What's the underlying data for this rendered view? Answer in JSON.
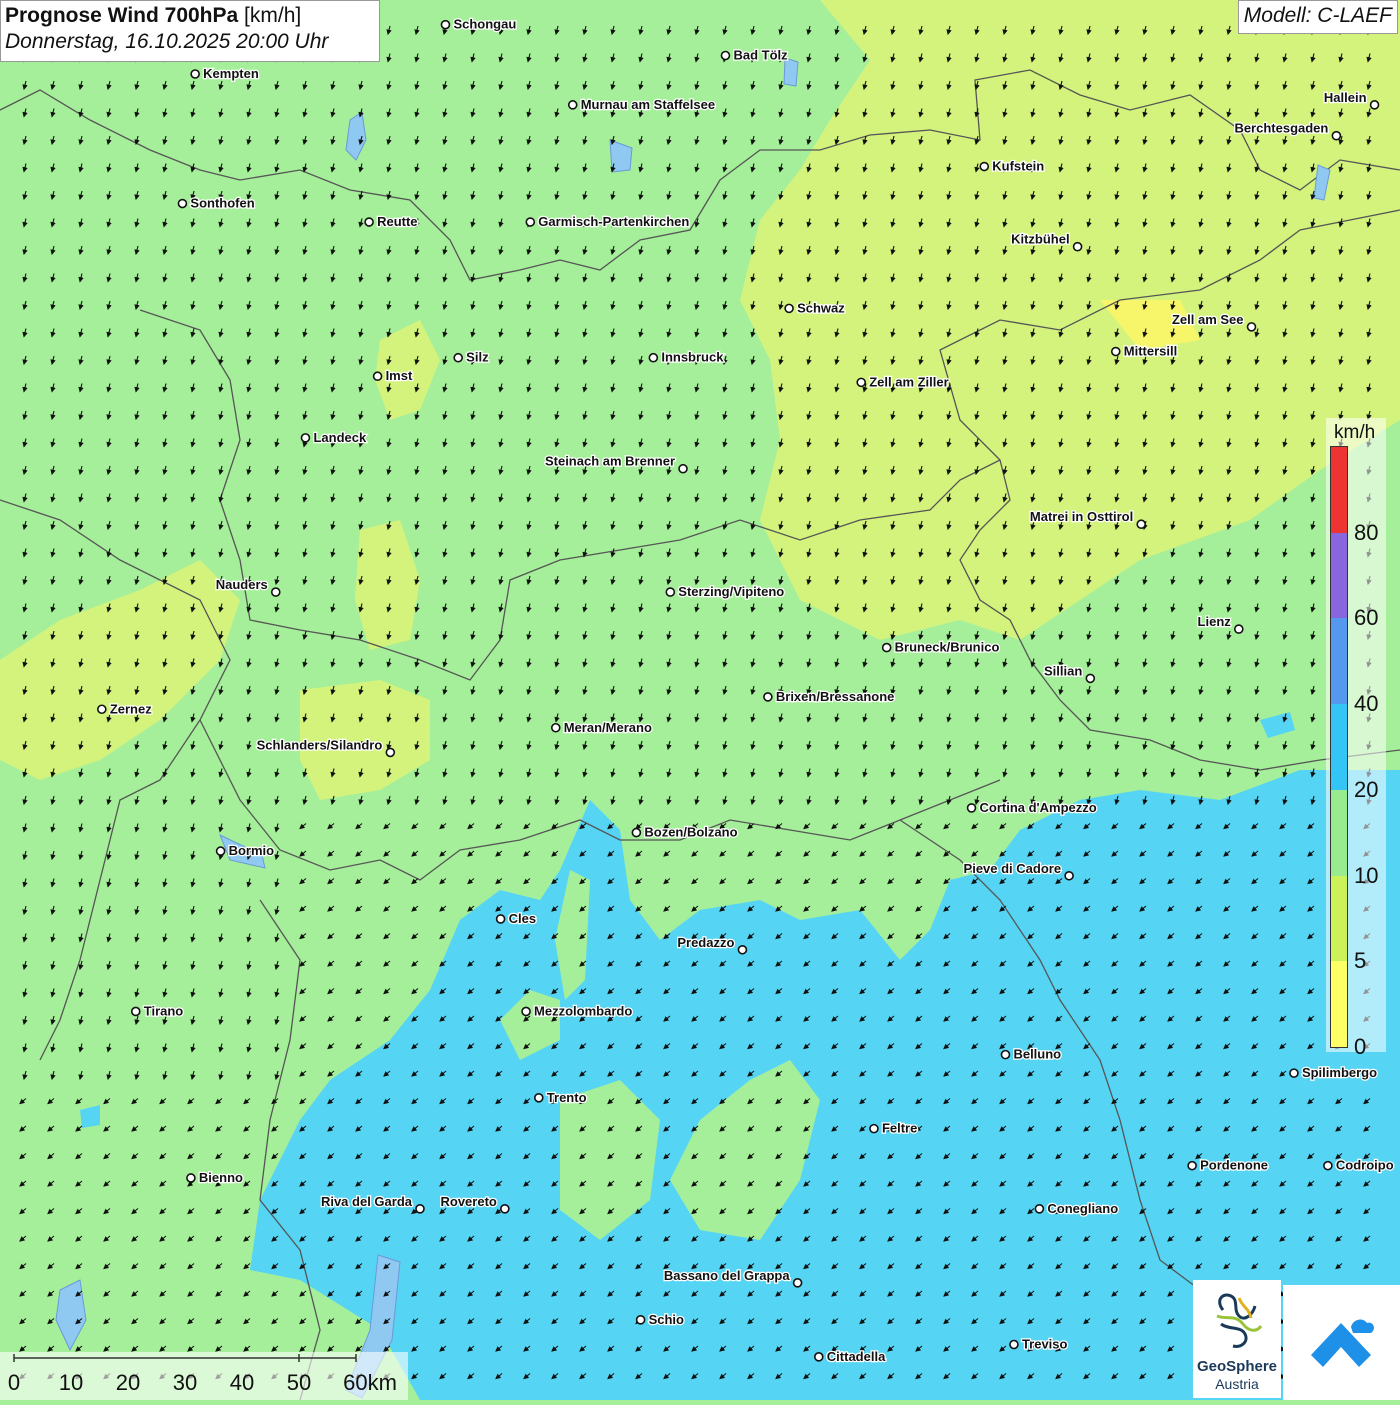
{
  "header": {
    "title_bold": "Prognose Wind 700hPa",
    "title_unit": "[km/h]",
    "subtitle": "Donnerstag, 16.10.2025 20:00 Uhr",
    "model": "Modell: C-LAEF"
  },
  "legend": {
    "unit": "km/h",
    "ticks": [
      "0",
      "5",
      "10",
      "20",
      "40",
      "60",
      "80"
    ],
    "colors": [
      "#ffff66",
      "#ccf25a",
      "#99eb8f",
      "#33c5f5",
      "#5599ee",
      "#8866dd",
      "#ee3333"
    ]
  },
  "scale_bar": {
    "labels": [
      "0",
      "10",
      "20",
      "30",
      "40",
      "50",
      "60km"
    ]
  },
  "logo": {
    "name_line1": "GeoSphere",
    "name_line2": "Austria"
  },
  "places": [
    {
      "name": "Schongau",
      "lon": 10.9,
      "lat": 47.81
    },
    {
      "name": "Bad Tölz",
      "lon": 11.56,
      "lat": 47.76
    },
    {
      "name": "Kempten",
      "lon": 10.31,
      "lat": 47.73
    },
    {
      "name": "Murnau am Staffelsee",
      "lon": 11.2,
      "lat": 47.68
    },
    {
      "name": "Hallein",
      "lon": 13.09,
      "lat": 47.68
    },
    {
      "name": "Berchtesgaden",
      "lon": 13.0,
      "lat": 47.63
    },
    {
      "name": "Kufstein",
      "lon": 12.17,
      "lat": 47.58
    },
    {
      "name": "Sonthofen",
      "lon": 10.28,
      "lat": 47.52
    },
    {
      "name": "Reutte",
      "lon": 10.72,
      "lat": 47.49
    },
    {
      "name": "Garmisch-Partenkirchen",
      "lon": 11.1,
      "lat": 47.49
    },
    {
      "name": "Kitzbühel",
      "lon": 12.39,
      "lat": 47.45
    },
    {
      "name": "Schwaz",
      "lon": 11.71,
      "lat": 47.35
    },
    {
      "name": "Zell am See",
      "lon": 12.8,
      "lat": 47.32
    },
    {
      "name": "Mittersill",
      "lon": 12.48,
      "lat": 47.28
    },
    {
      "name": "Innsbruck",
      "lon": 11.39,
      "lat": 47.27
    },
    {
      "name": "Silz",
      "lon": 10.93,
      "lat": 47.27
    },
    {
      "name": "Imst",
      "lon": 10.74,
      "lat": 47.24
    },
    {
      "name": "Zell am Ziller",
      "lon": 11.88,
      "lat": 47.23
    },
    {
      "name": "Landeck",
      "lon": 10.57,
      "lat": 47.14
    },
    {
      "name": "Steinach am Brenner",
      "lon": 11.46,
      "lat": 47.09
    },
    {
      "name": "Matrei in Osttirol",
      "lon": 12.54,
      "lat": 47.0
    },
    {
      "name": "Nauders",
      "lon": 10.5,
      "lat": 46.89
    },
    {
      "name": "Sterzing/Vipiteno",
      "lon": 11.43,
      "lat": 46.89
    },
    {
      "name": "Lienz",
      "lon": 12.77,
      "lat": 46.83
    },
    {
      "name": "Bruneck/Brunico",
      "lon": 11.94,
      "lat": 46.8
    },
    {
      "name": "Sillian",
      "lon": 12.42,
      "lat": 46.75
    },
    {
      "name": "Zernez",
      "lon": 10.09,
      "lat": 46.7
    },
    {
      "name": "Brixen/Bressanone",
      "lon": 11.66,
      "lat": 46.72
    },
    {
      "name": "Meran/Merano",
      "lon": 11.16,
      "lat": 46.67
    },
    {
      "name": "Schlanders/Silandro",
      "lon": 10.77,
      "lat": 46.63
    },
    {
      "name": "Cortina d'Ampezzo",
      "lon": 12.14,
      "lat": 46.54
    },
    {
      "name": "Bozen/Bolzano",
      "lon": 11.35,
      "lat": 46.5
    },
    {
      "name": "Bormio",
      "lon": 10.37,
      "lat": 46.47
    },
    {
      "name": "Pieve di Cadore",
      "lon": 12.37,
      "lat": 46.43
    },
    {
      "name": "Cles",
      "lon": 11.03,
      "lat": 46.36
    },
    {
      "name": "Predazzo",
      "lon": 11.6,
      "lat": 46.31
    },
    {
      "name": "Tirano",
      "lon": 10.17,
      "lat": 46.21
    },
    {
      "name": "Mezzolombardo",
      "lon": 11.09,
      "lat": 46.21
    },
    {
      "name": "Belluno",
      "lon": 12.22,
      "lat": 46.14
    },
    {
      "name": "Spilimbergo",
      "lon": 12.9,
      "lat": 46.11
    },
    {
      "name": "Trento",
      "lon": 11.12,
      "lat": 46.07
    },
    {
      "name": "Feltre",
      "lon": 11.91,
      "lat": 46.02
    },
    {
      "name": "Pordenone",
      "lon": 12.66,
      "lat": 45.96
    },
    {
      "name": "Codroipo",
      "lon": 12.98,
      "lat": 45.96
    },
    {
      "name": "Bienno",
      "lon": 10.3,
      "lat": 45.94
    },
    {
      "name": "Riva del Garda",
      "lon": 10.84,
      "lat": 45.89
    },
    {
      "name": "Rovereto",
      "lon": 11.04,
      "lat": 45.89
    },
    {
      "name": "Conegliano",
      "lon": 12.3,
      "lat": 45.89
    },
    {
      "name": "Bassano del Grappa",
      "lon": 11.73,
      "lat": 45.77
    },
    {
      "name": "Schio",
      "lon": 11.36,
      "lat": 45.71
    },
    {
      "name": "Cittadella",
      "lon": 11.78,
      "lat": 45.65
    },
    {
      "name": "Treviso",
      "lon": 12.24,
      "lat": 45.67
    }
  ]
}
